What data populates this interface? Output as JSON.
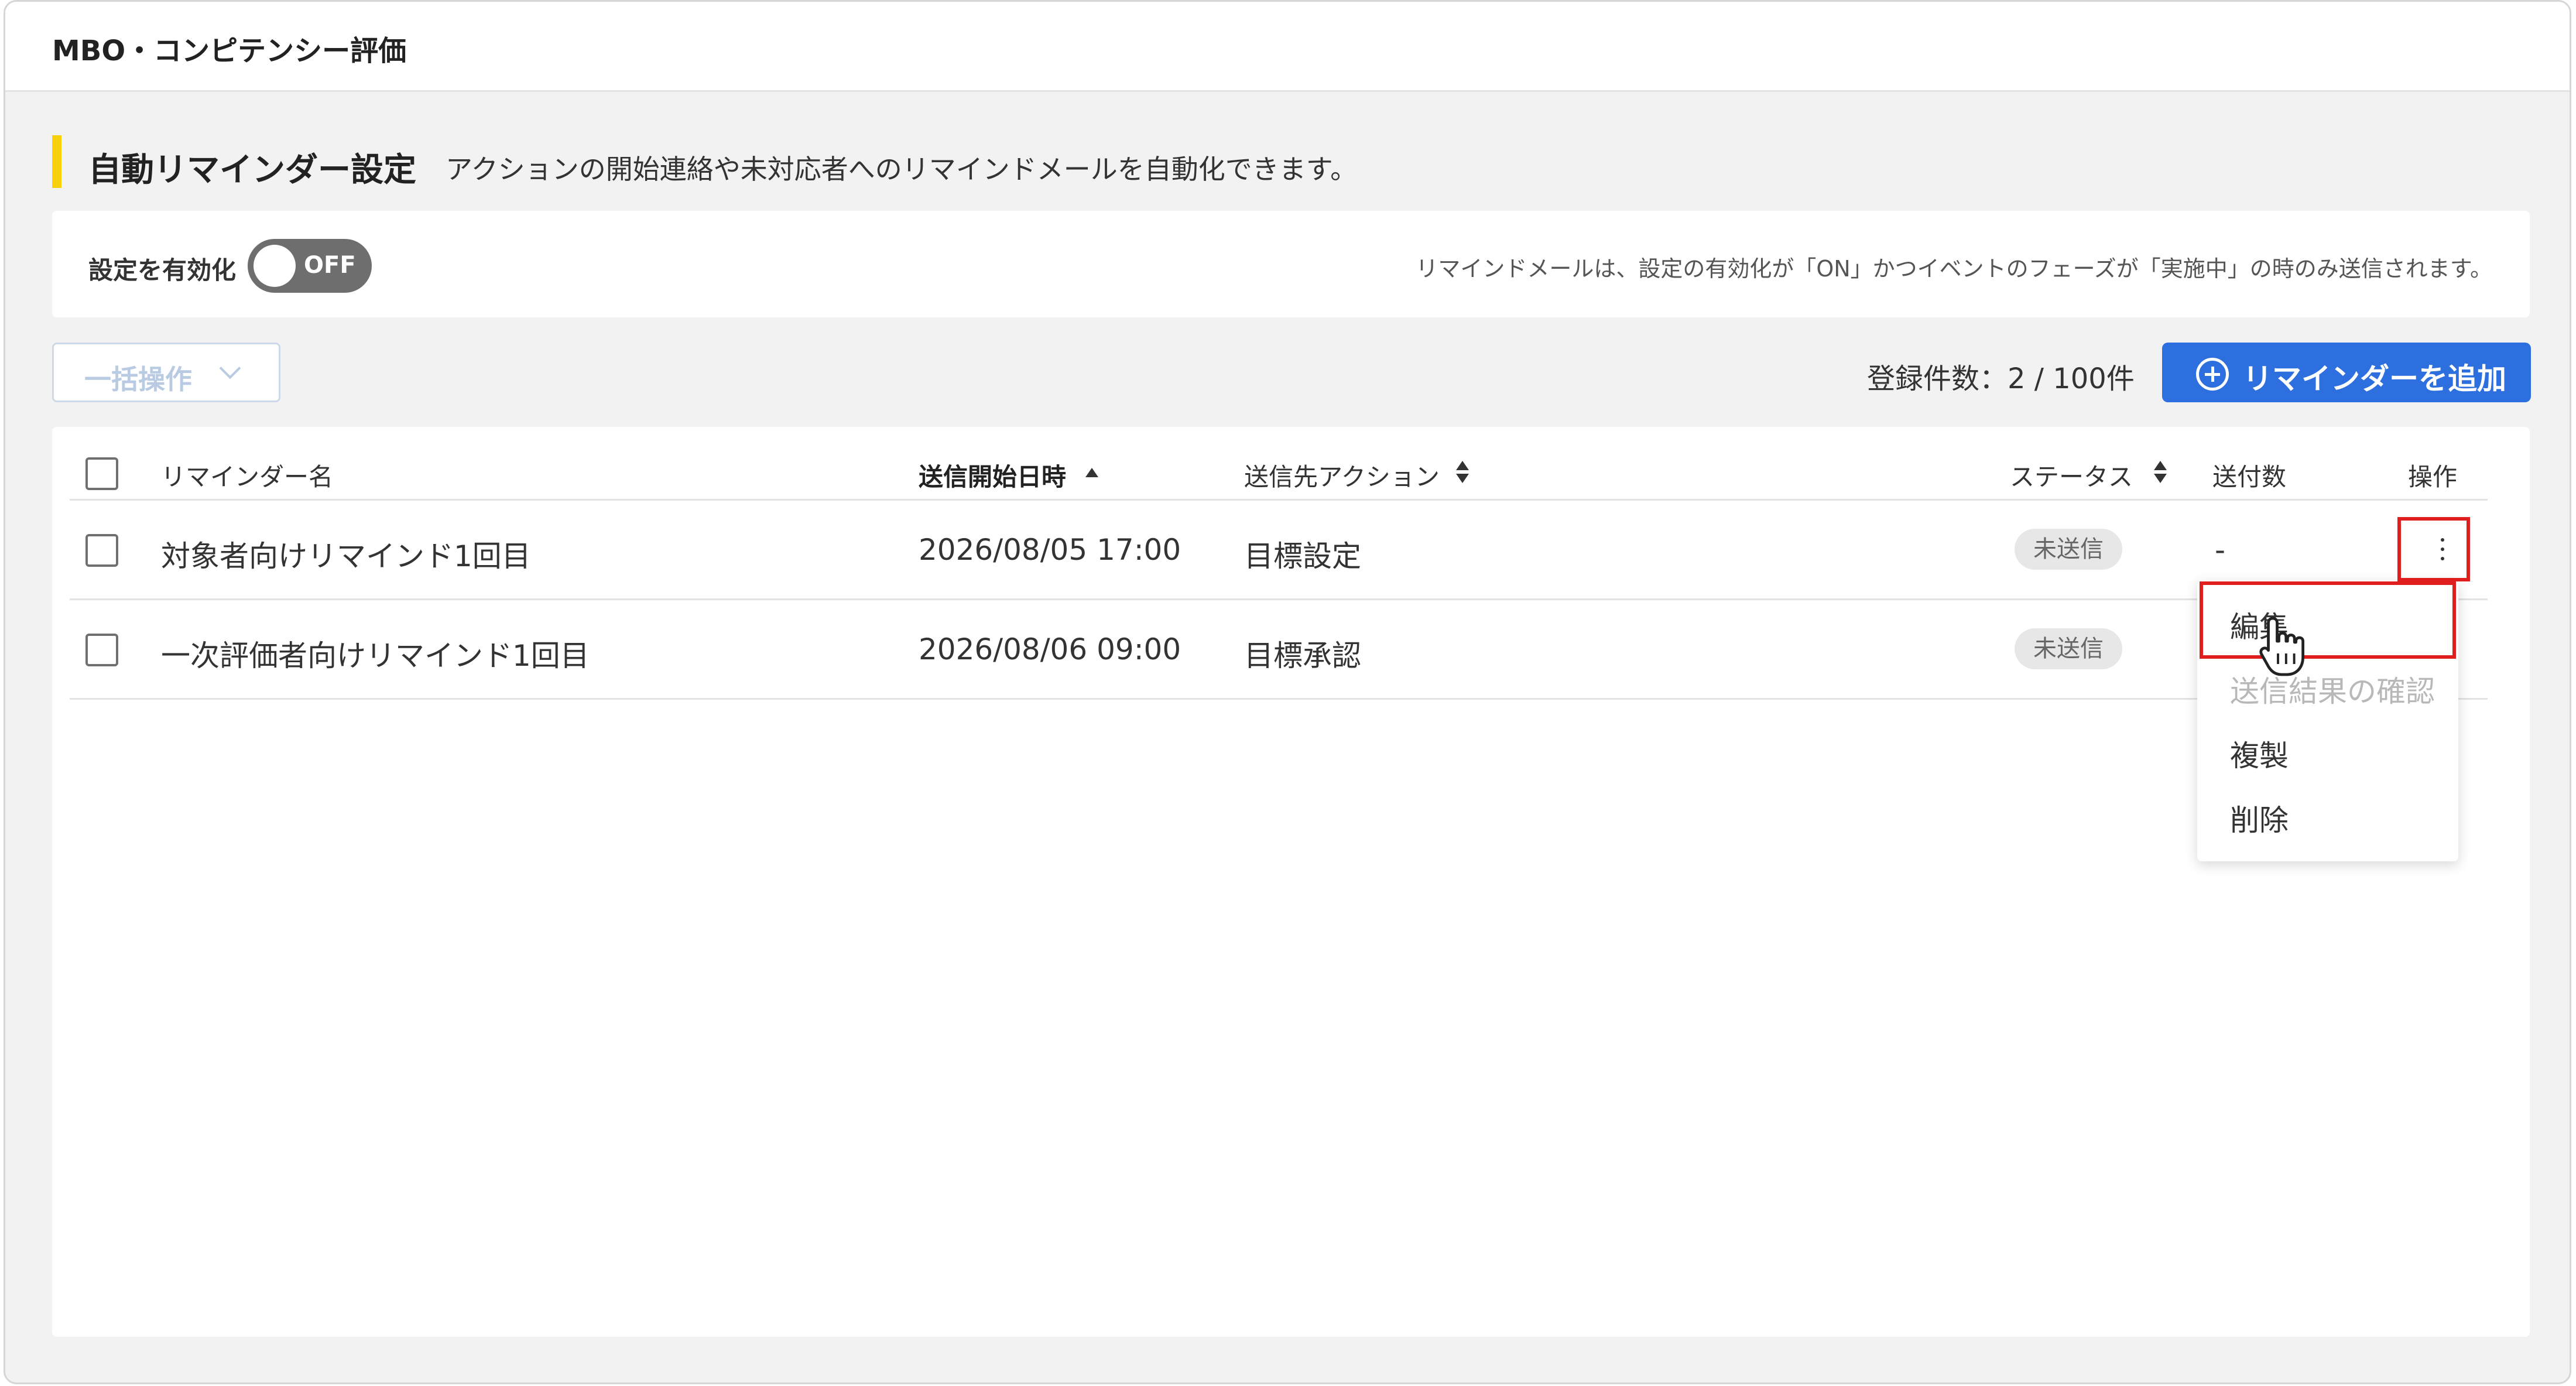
{
  "app": {
    "title": "MBO・コンピテンシー評価"
  },
  "section": {
    "title": "自動リマインダー設定",
    "description": "アクションの開始連絡や未対応者へのリマインドメールを自動化できます。",
    "accent_color": "#f6d10c"
  },
  "settings": {
    "toggle_label": "設定を有効化",
    "toggle_state": "OFF",
    "note": "リマインドメールは、設定の有効化が「ON」かつイベントのフェーズが「実施中」の時のみ送信されます。"
  },
  "toolbar": {
    "bulk_label": "一括操作",
    "count_text": "登録件数：2 / 100件",
    "add_label": "リマインダーを追加",
    "add_color": "#2e6fe0"
  },
  "table": {
    "columns": {
      "name": "リマインダー名",
      "start": "送信開始日時",
      "action": "送信先アクション",
      "status": "ステータス",
      "sent": "送付数",
      "ops": "操作"
    },
    "rows": [
      {
        "name": "対象者向けリマインド1回目",
        "start": "2026/08/05 17:00",
        "action": "目標設定",
        "status": "未送信",
        "sent": "-"
      },
      {
        "name": "一次評価者向けリマインド1回目",
        "start": "2026/08/06 09:00",
        "action": "目標承認",
        "status": "未送信",
        "sent": ""
      }
    ]
  },
  "menu": {
    "items": [
      {
        "label": "編集",
        "enabled": true
      },
      {
        "label": "送信結果の確認",
        "enabled": false
      },
      {
        "label": "複製",
        "enabled": true
      },
      {
        "label": "削除",
        "enabled": true
      }
    ]
  },
  "highlight_color": "#e01e1e"
}
